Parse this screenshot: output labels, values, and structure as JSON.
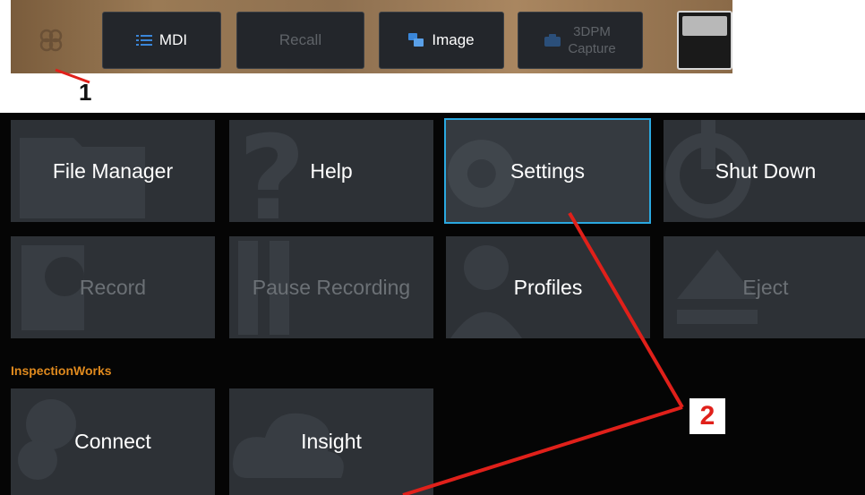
{
  "toolbar": {
    "mdi_label": "MDI",
    "recall_label": "Recall",
    "image_label": "Image",
    "capture_line1": "3DPM",
    "capture_line2": "Capture"
  },
  "callouts": {
    "one": "1",
    "two": "2"
  },
  "tiles": {
    "file_manager": "File Manager",
    "help": "Help",
    "settings": "Settings",
    "shut_down": "Shut Down",
    "record": "Record",
    "pause_recording": "Pause Recording",
    "profiles": "Profiles",
    "eject": "Eject",
    "connect": "Connect",
    "insight": "Insight"
  },
  "section": {
    "inspectionworks": "InspectionWorks"
  },
  "colors": {
    "accent": "#2aa8e0",
    "section": "#e08a1e",
    "annotation": "#e0201a"
  }
}
